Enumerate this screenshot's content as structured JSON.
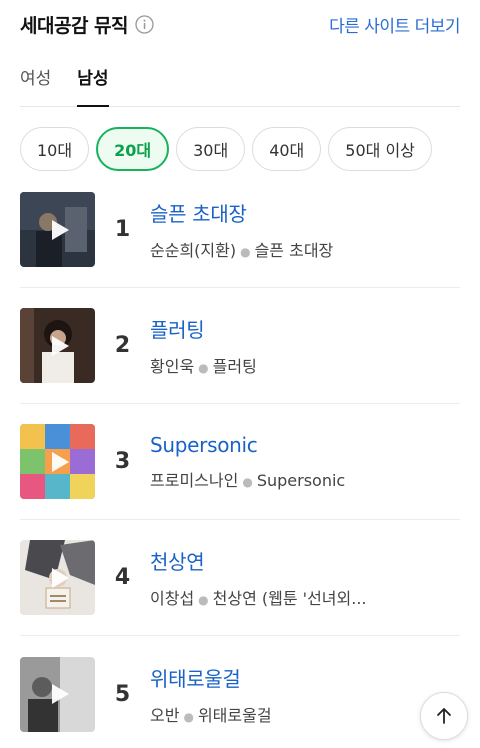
{
  "header": {
    "title": "세대공감 뮤직",
    "more_link": "다른 사이트 더보기",
    "info_icon": "info-icon"
  },
  "tabs": [
    {
      "label": "여성",
      "active": false
    },
    {
      "label": "남성",
      "active": true
    }
  ],
  "age_chips": [
    {
      "label": "10대",
      "active": false
    },
    {
      "label": "20대",
      "active": true
    },
    {
      "label": "30대",
      "active": false
    },
    {
      "label": "40대",
      "active": false
    },
    {
      "label": "50대 이상",
      "active": false
    }
  ],
  "songs": [
    {
      "rank": "1",
      "title": "슬픈 초대장",
      "artist": "순순희(지환)",
      "album": "슬픈 초대장"
    },
    {
      "rank": "2",
      "title": "플러팅",
      "artist": "황인욱",
      "album": "플러팅"
    },
    {
      "rank": "3",
      "title": "Supersonic",
      "artist": "프로미스나인",
      "album": "Supersonic"
    },
    {
      "rank": "4",
      "title": "천상연",
      "artist": "이창섭",
      "album": "천상연 (웹툰 '선녀외..."
    },
    {
      "rank": "5",
      "title": "위태로울걸",
      "artist": "오반",
      "album": "위태로울걸"
    }
  ],
  "colors": {
    "accent_green": "#17b35b",
    "link_blue": "#1a62c7"
  },
  "scroll_top_icon": "arrow-up-icon"
}
